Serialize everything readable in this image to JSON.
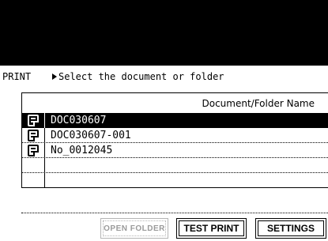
{
  "header": {
    "mode_label": "PRINT",
    "prompt": "Select the document or folder"
  },
  "table": {
    "column_header": "Document/Folder Name",
    "rows": [
      {
        "name": "DOC030607",
        "icon": "document-icon",
        "selected": true
      },
      {
        "name": "DOC030607-001",
        "icon": "document-icon",
        "selected": false
      },
      {
        "name": "No_0012045",
        "icon": "document-icon",
        "selected": false
      },
      {
        "name": "",
        "icon": "",
        "selected": false
      },
      {
        "name": "",
        "icon": "",
        "selected": false
      }
    ]
  },
  "buttons": {
    "open_folder": "OPEN FOLDER",
    "test_print": "TEST PRINT",
    "settings": "SETTINGS"
  },
  "colors": {
    "selected_background": "#000000",
    "selected_text": "#ffffff",
    "disabled_text": "#9a9a9a"
  }
}
